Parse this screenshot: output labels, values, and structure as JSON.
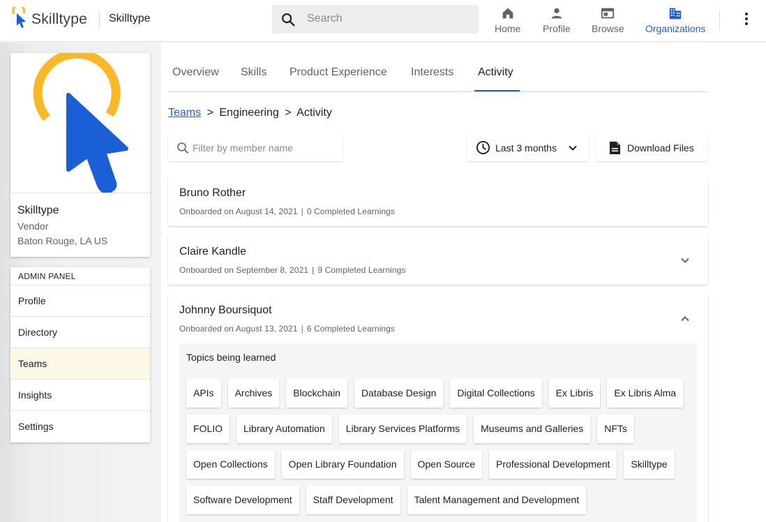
{
  "header": {
    "brand_name": "Skilltype",
    "org_name": "Skilltype",
    "search_placeholder": "Search",
    "nav": [
      {
        "label": "Home",
        "icon": "home-icon"
      },
      {
        "label": "Profile",
        "icon": "person-icon"
      },
      {
        "label": "Browse",
        "icon": "browse-icon"
      },
      {
        "label": "Organizations",
        "icon": "building-icon",
        "active": true
      }
    ],
    "colors": {
      "accent": "#1a5fd6",
      "brand_yellow": "#f9b82a"
    }
  },
  "profile_card": {
    "name": "Skilltype",
    "type": "Vendor",
    "location": "Baton Rouge, LA US"
  },
  "admin_panel": {
    "title": "ADMIN PANEL",
    "items": [
      {
        "label": "Profile"
      },
      {
        "label": "Directory"
      },
      {
        "label": "Teams",
        "active": true
      },
      {
        "label": "Insights"
      },
      {
        "label": "Settings"
      }
    ]
  },
  "tabs": [
    {
      "label": "Overview"
    },
    {
      "label": "Skills"
    },
    {
      "label": "Product Experience"
    },
    {
      "label": "Interests"
    },
    {
      "label": "Activity",
      "active": true
    }
  ],
  "breadcrumb": {
    "link": "Teams",
    "sep": ">",
    "middle": "Engineering",
    "current": "Activity"
  },
  "controls": {
    "filter_placeholder": "Filter by member name",
    "range_label": "Last 3 months",
    "download_label": "Download Files"
  },
  "members": [
    {
      "name": "Bruno Rother",
      "onboarded": "Onboarded on August 14, 2021",
      "learnings": "0 Completed Learnings"
    },
    {
      "name": "Claire Kandle",
      "onboarded": "Onboarded on September 8, 2021",
      "learnings": "9 Completed Learnings"
    },
    {
      "name": "Johnny Boursiquot",
      "onboarded": "Onboarded on August 13, 2021",
      "learnings": "6 Completed Learnings"
    }
  ],
  "meta_sep": "|",
  "topics": {
    "title": "Topics being learned",
    "chips": [
      "APIs",
      "Archives",
      "Blockchain",
      "Database Design",
      "Digital Collections",
      "Ex Libris",
      "Ex Libris Alma",
      "FOLIO",
      "Library Automation",
      "Library Services Platforms",
      "Museums and Galleries",
      "NFTs",
      "Open Collections",
      "Open Library Foundation",
      "Open Source",
      "Professional Development",
      "Skilltype",
      "Software Development",
      "Staff Development",
      "Talent Management and Development"
    ]
  }
}
